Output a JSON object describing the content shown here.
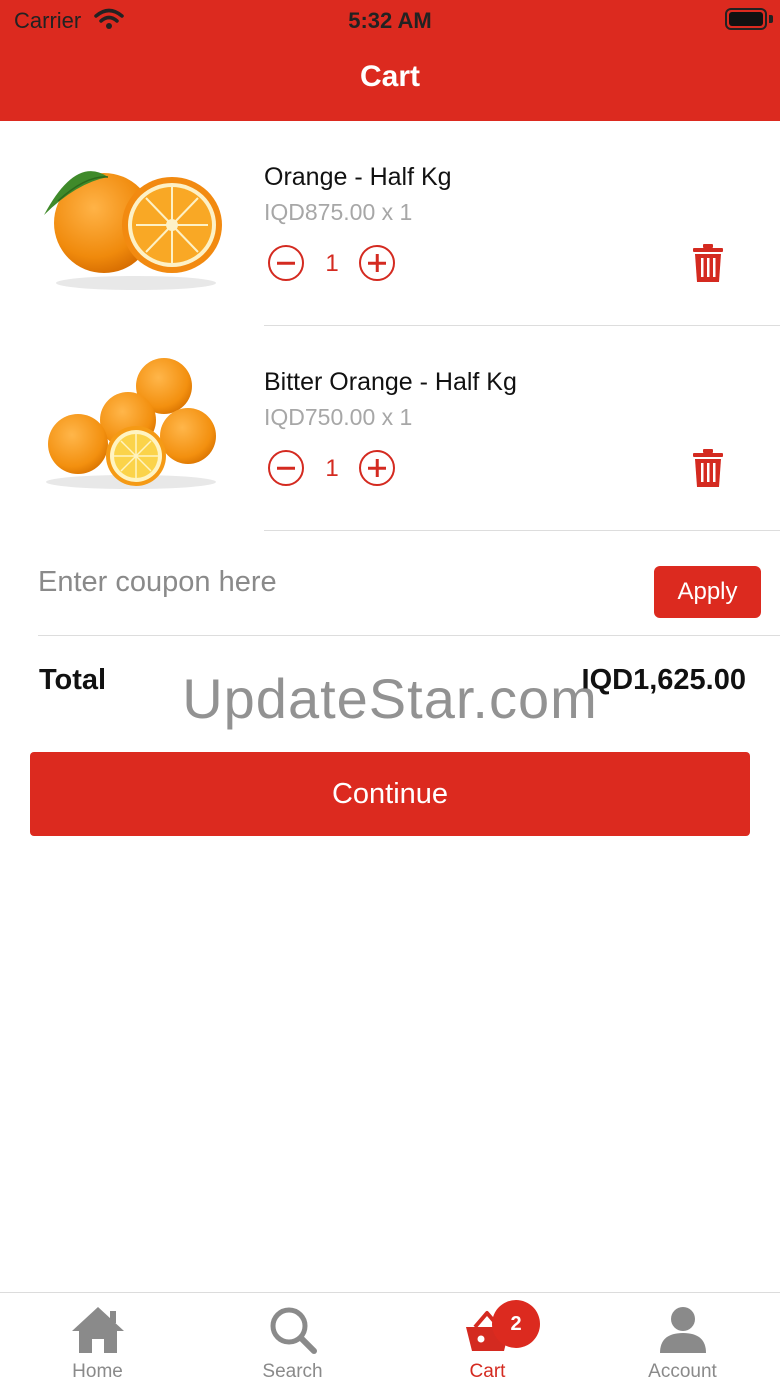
{
  "status_bar": {
    "carrier": "Carrier",
    "time": "5:32 AM"
  },
  "header": {
    "title": "Cart"
  },
  "cart_items": [
    {
      "name": "Orange - Half Kg",
      "price": "IQD875.00 x 1",
      "quantity": "1",
      "image_icon": "orange-image"
    },
    {
      "name": "Bitter Orange - Half Kg",
      "price": "IQD750.00 x 1",
      "quantity": "1",
      "image_icon": "bitter-orange-image"
    }
  ],
  "coupon": {
    "placeholder": "Enter coupon here",
    "apply_label": "Apply"
  },
  "total": {
    "label": "Total",
    "value": "IQD1,625.00"
  },
  "watermark": "UpdateStar.com",
  "continue_label": "Continue",
  "tabbar": {
    "tabs": [
      {
        "label": "Home",
        "icon": "home-icon"
      },
      {
        "label": "Search",
        "icon": "search-icon"
      },
      {
        "label": "Cart",
        "icon": "cart-icon",
        "badge": "2"
      },
      {
        "label": "Account",
        "icon": "account-icon"
      }
    ]
  },
  "colors": {
    "accent": "#dc2a1f",
    "inactive": "#8a8a8a",
    "muted_text": "#a7a7a7"
  }
}
